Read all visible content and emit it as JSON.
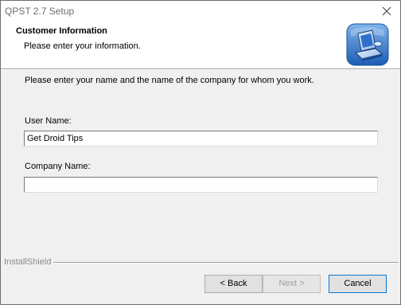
{
  "window": {
    "title": "QPST 2.7 Setup",
    "close_icon": "close-icon"
  },
  "header": {
    "title": "Customer Information",
    "subtitle": "Please enter your information.",
    "logo_icon": "installer-computer-icon"
  },
  "main": {
    "instruction": "Please enter your name and the name of the company for whom you work.",
    "user_name_label": "User Name:",
    "user_name_value": "Get Droid Tips",
    "company_name_label": "Company Name:",
    "company_name_value": ""
  },
  "footer": {
    "brand": "InstallShield",
    "back_label": "< Back",
    "next_label": "Next >",
    "cancel_label": "Cancel"
  },
  "colors": {
    "accent": "#0078d7",
    "dialog_bg": "#f0f0f0",
    "header_bg": "#ffffff"
  }
}
